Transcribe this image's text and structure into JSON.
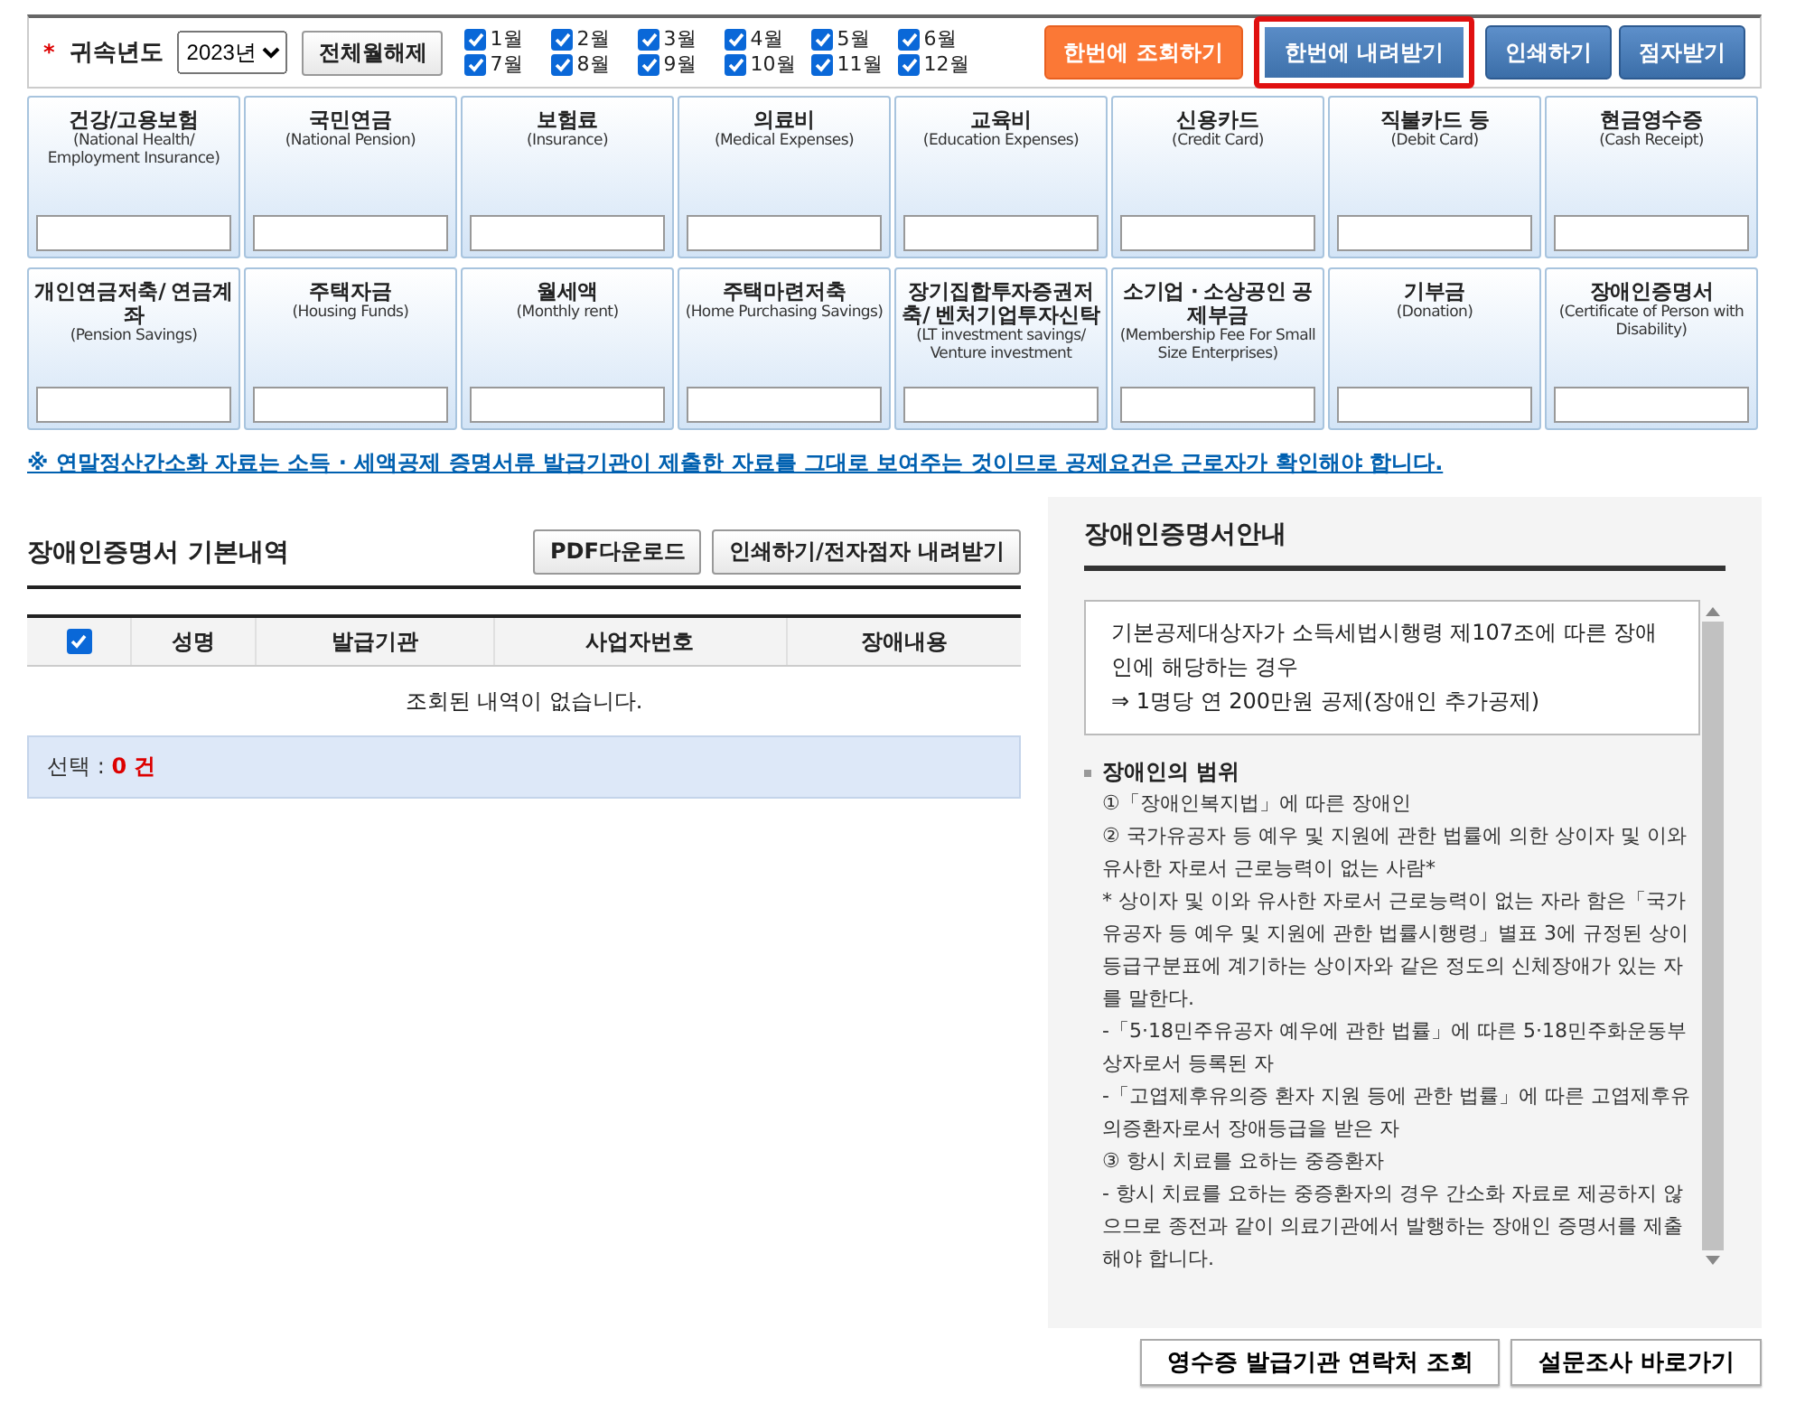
{
  "toolbar": {
    "year_label": "귀속년도",
    "required_mark": "*",
    "year_select": {
      "value": "2023년"
    },
    "clear_months_button": "전체월해제",
    "months": [
      {
        "label": "1월",
        "checked": true
      },
      {
        "label": "2월",
        "checked": true
      },
      {
        "label": "3월",
        "checked": true
      },
      {
        "label": "4월",
        "checked": true
      },
      {
        "label": "5월",
        "checked": true
      },
      {
        "label": "6월",
        "checked": true
      },
      {
        "label": "7월",
        "checked": true
      },
      {
        "label": "8월",
        "checked": true
      },
      {
        "label": "9월",
        "checked": true
      },
      {
        "label": "10월",
        "checked": true
      },
      {
        "label": "11월",
        "checked": true
      },
      {
        "label": "12월",
        "checked": true
      }
    ],
    "buttons": [
      {
        "label": "한번에 조회하기",
        "kind": "orange",
        "highlighted": false
      },
      {
        "label": "한번에 내려받기",
        "kind": "blue",
        "highlighted": true
      },
      {
        "label": "인쇄하기",
        "kind": "blue",
        "highlighted": false
      },
      {
        "label": "점자받기",
        "kind": "blue",
        "highlighted": false
      }
    ]
  },
  "categories": [
    {
      "title": "건강/고용보험",
      "subtitle": "(National Health/ Employment Insurance)"
    },
    {
      "title": "국민연금",
      "subtitle": "(National Pension)"
    },
    {
      "title": "보험료",
      "subtitle": "(Insurance)"
    },
    {
      "title": "의료비",
      "subtitle": "(Medical Expenses)"
    },
    {
      "title": "교육비",
      "subtitle": "(Education Expenses)"
    },
    {
      "title": "신용카드",
      "subtitle": "(Credit Card)"
    },
    {
      "title": "직불카드 등",
      "subtitle": "(Debit Card)"
    },
    {
      "title": "현금영수증",
      "subtitle": "(Cash Receipt)"
    },
    {
      "title": "개인연금저축/ 연금계좌",
      "subtitle": "(Pension Savings)"
    },
    {
      "title": "주택자금",
      "subtitle": "(Housing Funds)"
    },
    {
      "title": "월세액",
      "subtitle": "(Monthly rent)"
    },
    {
      "title": "주택마련저축",
      "subtitle": "(Home Purchasing Savings)"
    },
    {
      "title": "장기집합투자증권저축/ 벤처기업투자신탁",
      "subtitle": "(LT investment savings/ Venture investment"
    },
    {
      "title": "소기업 · 소상공인 공제부금",
      "subtitle": "(Membership Fee For Small Size Enterprises)"
    },
    {
      "title": "기부금",
      "subtitle": "(Donation)"
    },
    {
      "title": "장애인증명서",
      "subtitle": "(Certificate of Person with Disability)"
    }
  ],
  "notice": "※ 연말정산간소화 자료는 소득 · 세액공제 증명서류 발급기관이 제출한 자료를 그대로 보여주는 것이므로 공제요건은 근로자가 확인해야 합니다.",
  "details": {
    "title": "장애인증명서 기본내역",
    "buttons": [
      "PDF다운로드",
      "인쇄하기/전자점자 내려받기"
    ],
    "table": {
      "select_all_checked": true,
      "columns": [
        "성명",
        "발급기관",
        "사업자번호",
        "장애내용"
      ],
      "empty_message": "조회된 내역이 없습니다."
    },
    "selection_label": "선택 :",
    "selection_count": "0 건"
  },
  "guide": {
    "title": "장애인증명서안내",
    "summary": [
      "기본공제대상자가 소득세법시행령 제107조에 따른 장애인에 해당하는 경우",
      "⇒ 1명당 연 200만원 공제(장애인 추가공제)"
    ],
    "section_title": "장애인의 범위",
    "paragraphs": [
      "①「장애인복지법」에 따른 장애인",
      "② 국가유공자 등 예우 및 지원에 관한 법률에 의한 상이자 및 이와 유사한 자로서 근로능력이 없는 사람*",
      "* 상이자 및 이와 유사한 자로서 근로능력이 없는 자라 함은「국가유공자 등 예우 및 지원에 관한 법률시행령」별표 3에 규정된 상이등급구분표에 계기하는 상이자와 같은 정도의 신체장애가 있는 자를 말한다.",
      "-「5·18민주유공자 예우에 관한 법률」에 따른 5·18민주화운동부상자로서 등록된 자",
      "-「고엽제후유의증 환자 지원 등에 관한 법률」에 따른 고엽제후유의증환자로서 장애등급을 받은 자",
      "③ 항시 치료를 요하는 중증환자",
      "- 항시 치료를 요하는 중증환자의 경우 간소화 자료로 제공하지 않으므로 종전과 같이 의료기관에서 발행하는 장애인 증명서를 제출해야 합니다."
    ]
  },
  "footer_buttons": [
    "영수증 발급기관 연락처 조회",
    "설문조사 바로가기"
  ]
}
